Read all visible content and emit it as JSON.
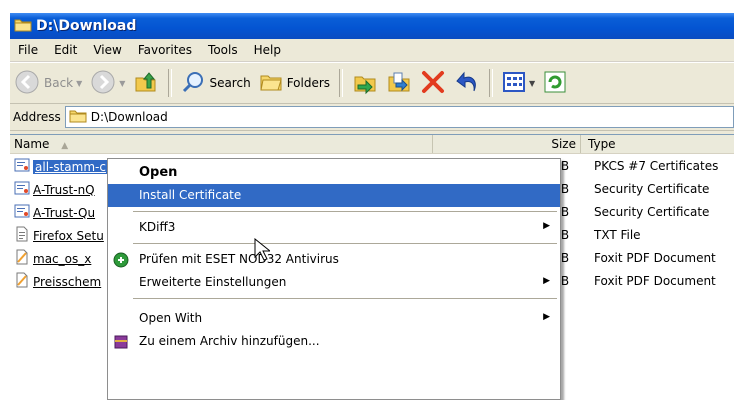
{
  "window": {
    "title": "D:\\Download"
  },
  "menubar": {
    "items": [
      "File",
      "Edit",
      "View",
      "Favorites",
      "Tools",
      "Help"
    ]
  },
  "toolbar": {
    "back_label": "Back",
    "search_label": "Search",
    "folders_label": "Folders"
  },
  "address": {
    "label": "Address",
    "value": "D:\\Download"
  },
  "columns": {
    "name": "Name",
    "size": "Size",
    "type": "Type"
  },
  "files": [
    {
      "name": "all-stamm-c",
      "size": "KB",
      "type": "PKCS #7 Certificates",
      "icon": "certificate-icon",
      "selected": true
    },
    {
      "name": "A-Trust-nQ",
      "size": "KB",
      "type": "Security Certificate",
      "icon": "certificate-icon"
    },
    {
      "name": "A-Trust-Qu",
      "size": "KB",
      "type": "Security Certificate",
      "icon": "certificate-icon"
    },
    {
      "name": "Firefox Setu",
      "size": "KB",
      "type": "TXT File",
      "icon": "text-file-icon"
    },
    {
      "name": "mac_os_x",
      "size": "KB",
      "type": "Foxit PDF Document",
      "icon": "pdf-icon"
    },
    {
      "name": "Preisschem",
      "size": "KB",
      "type": "Foxit PDF Document",
      "icon": "pdf-icon"
    }
  ],
  "context_menu": {
    "open": "Open",
    "install_certificate": "Install Certificate",
    "kdiff3": "KDiff3",
    "eset_scan": "Prüfen mit ESET NOD32 Antivirus",
    "advanced_settings": "Erweiterte Einstellungen",
    "open_with": "Open With",
    "add_to_archive": "Zu einem Archiv hinzufügen..."
  },
  "colors": {
    "titlebar": "#0454d2",
    "selection": "#316ac5",
    "chrome": "#ece9d8"
  }
}
